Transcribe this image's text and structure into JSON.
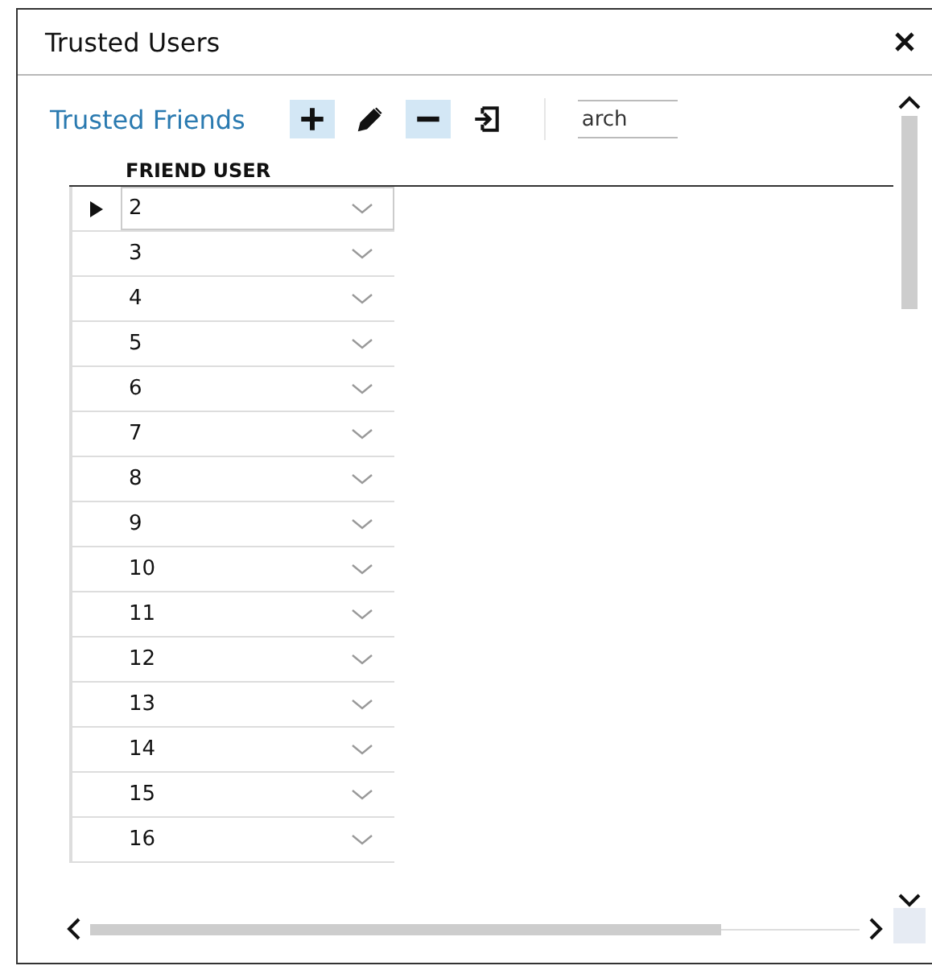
{
  "window": {
    "title": "Trusted Users"
  },
  "panel": {
    "title": "Trusted Friends",
    "tools": [
      {
        "kind": "add",
        "highlighted": true
      },
      {
        "kind": "edit",
        "highlighted": false
      },
      {
        "kind": "remove",
        "highlighted": true
      },
      {
        "kind": "import",
        "highlighted": false
      }
    ],
    "search": {
      "placeholder": "arch"
    }
  },
  "table": {
    "columns": [
      "FRIEND USER"
    ],
    "rows": [
      {
        "value": "2",
        "selected": true
      },
      {
        "value": "3",
        "selected": false
      },
      {
        "value": "4",
        "selected": false
      },
      {
        "value": "5",
        "selected": false
      },
      {
        "value": "6",
        "selected": false
      },
      {
        "value": "7",
        "selected": false
      },
      {
        "value": "8",
        "selected": false
      },
      {
        "value": "9",
        "selected": false
      },
      {
        "value": "10",
        "selected": false
      },
      {
        "value": "11",
        "selected": false
      },
      {
        "value": "12",
        "selected": false
      },
      {
        "value": "13",
        "selected": false
      },
      {
        "value": "14",
        "selected": false
      },
      {
        "value": "15",
        "selected": false
      },
      {
        "value": "16",
        "selected": false
      }
    ]
  }
}
